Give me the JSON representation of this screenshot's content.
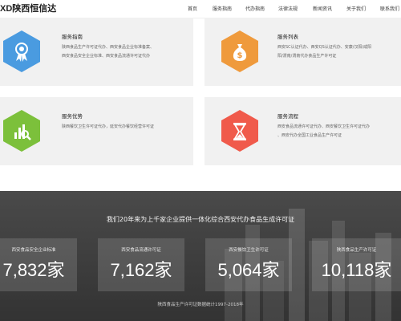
{
  "brand": {
    "mark": "XD",
    "name": "陕西恒信达"
  },
  "nav": [
    "首页",
    "服务指南",
    "代办指南",
    "法律法规",
    "新闻资讯",
    "关于我们",
    "联系我们"
  ],
  "cards": [
    {
      "title": "服务指南",
      "lines": [
        "陕西食品生产许可证代办、西安食品企业标准备案、",
        "西安食品安全企业标准、西安食品流通许可证代办"
      ],
      "color": "#4a9be0",
      "icon": "award-ribbon-icon"
    },
    {
      "title": "服务列表",
      "lines": [
        "西安SC认证代办、西安QS认证代办、安康/汉阳/咸阳",
        "阳/渭南/渭南代办食品生产许可证"
      ],
      "color": "#ef9a3c",
      "icon": "money-bag-icon"
    },
    {
      "title": "服务优势",
      "lines": [
        "陕西餐饮卫生许可证代办，延安代办餐饮经营许可证"
      ],
      "color": "#7cc03b",
      "icon": "chart-search-icon"
    },
    {
      "title": "服务流程",
      "lines": [
        "西安食品流通许可证代办、西安餐饮卫生许可证代办",
        "、西安代办全国工业食品生产许可证"
      ],
      "color": "#f05a4b",
      "icon": "hourglass-icon"
    }
  ],
  "stats": {
    "headline": "我们20年来为上千家企业提供一体化综合西安代办食品生成许可证",
    "items": [
      {
        "label": "西安食品安全企业标准",
        "value": "7,832家"
      },
      {
        "label": "西安食品流通许可证",
        "value": "7,162家"
      },
      {
        "label": "西安餐饮卫生许可证",
        "value": "5,064家"
      },
      {
        "label": "陕西食品生产许可证",
        "value": "10,118家"
      }
    ],
    "footer": "陕西食品生产许可证数据统计1997-2018年"
  }
}
